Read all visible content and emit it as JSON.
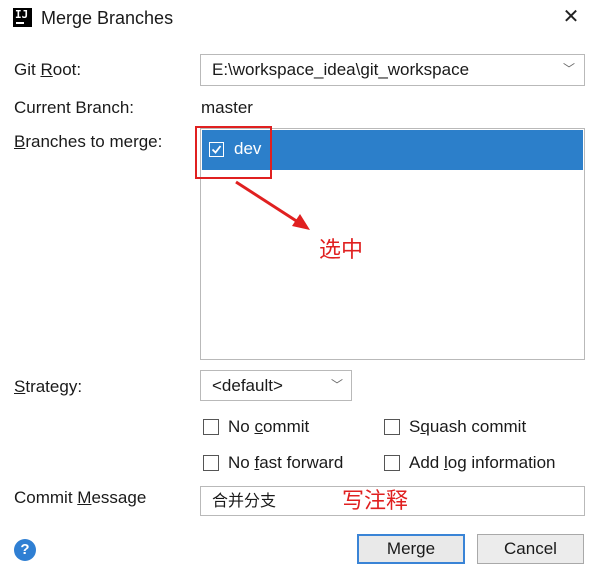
{
  "window": {
    "title": "Merge Branches",
    "app_icon_glyph": "IJ",
    "close_glyph": "✕"
  },
  "git_root": {
    "label_prefix": "Git ",
    "label_mnemonic": "R",
    "label_suffix": "oot:",
    "value": "E:\\workspace_idea\\git_workspace"
  },
  "current_branch": {
    "label": "Current Branch:",
    "value": "master"
  },
  "branches_to_merge": {
    "label_mnemonic": "B",
    "label_suffix": "ranches to merge:",
    "items": [
      {
        "name": "dev",
        "checked": true
      }
    ]
  },
  "annotations": {
    "select_note": "选中",
    "comment_note": "写注释",
    "color": "#e02020"
  },
  "strategy": {
    "label_mnemonic": "S",
    "label_suffix": "trategy:",
    "value": "<default>"
  },
  "options": {
    "no_commit": {
      "prefix": "No ",
      "mnemonic": "c",
      "suffix": "ommit",
      "checked": false
    },
    "squash_commit": {
      "prefix": "S",
      "mnemonic": "q",
      "suffix": "uash commit",
      "checked": false
    },
    "no_fast_forward": {
      "prefix": "No ",
      "mnemonic": "f",
      "suffix": "ast forward",
      "checked": false
    },
    "add_log_information": {
      "prefix": "Add ",
      "mnemonic": "l",
      "suffix": "og information",
      "checked": false
    }
  },
  "commit_message": {
    "label_prefix": "Commit ",
    "label_mnemonic": "M",
    "label_suffix": "essage",
    "value": "合并分支"
  },
  "buttons": {
    "help_glyph": "?",
    "merge": "Merge",
    "cancel": "Cancel"
  },
  "colors": {
    "selection": "#2c7fca",
    "primary_border": "#3a84d6",
    "help": "#2f7fd3"
  }
}
